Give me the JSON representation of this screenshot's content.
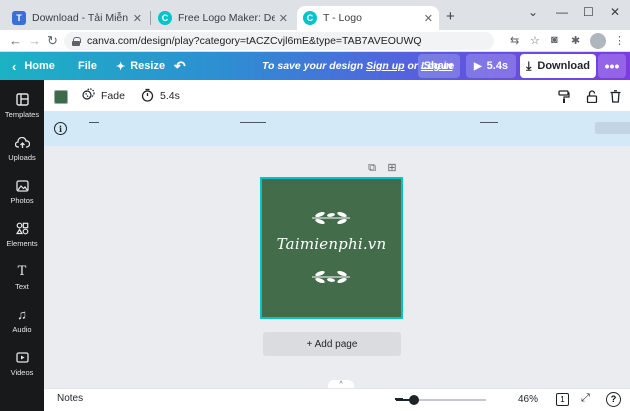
{
  "browser": {
    "tabs": [
      {
        "title": "Download - Tải Miễn Phí VN - Ph",
        "favicon": "T",
        "favicon_color": "#3a6fd8"
      },
      {
        "title": "Free Logo Maker: Design profess",
        "favicon": "C",
        "favicon_color": "#00c4cc"
      },
      {
        "title": "T - Logo",
        "favicon": "C",
        "favicon_color": "#00c4cc",
        "active": true
      }
    ],
    "new_tab": "+",
    "url": "canva.com/design/play?category=tACZCvjl6mE&type=TAB7AVEOUWQ"
  },
  "topbar": {
    "home_label": "Home",
    "file_label": "File",
    "resize_label": "Resize",
    "message_prefix": "To save your design ",
    "sign_up": "Sign up",
    "message_or": " or ",
    "log_in": "Log in",
    "share_label": "Share",
    "play_label": "5.4s",
    "download_label": "Download"
  },
  "sidebar": {
    "items": [
      {
        "label": "Templates",
        "icon": "templates-icon"
      },
      {
        "label": "Uploads",
        "icon": "upload-cloud-icon"
      },
      {
        "label": "Photos",
        "icon": "photos-icon"
      },
      {
        "label": "Elements",
        "icon": "elements-icon"
      },
      {
        "label": "Text",
        "icon": "text-icon"
      },
      {
        "label": "Audio",
        "icon": "music-note-icon"
      },
      {
        "label": "Videos",
        "icon": "video-icon"
      }
    ]
  },
  "editor_toolbar": {
    "color_swatch": "#3d6b4a",
    "fade_label": "Fade",
    "duration_label": "5.4s"
  },
  "canvas": {
    "background": "#436c4b",
    "logo_text": "Taimienphi.vn",
    "add_page_label": "+ Add page"
  },
  "bottombar": {
    "notes_label": "Notes",
    "zoom": "46%",
    "zoom_fraction": 0.46,
    "page_count": "1"
  },
  "colors": {
    "accent_teal": "#00c4cc",
    "accent_purple": "#7d3be3",
    "sidebar_bg": "#18191b"
  }
}
